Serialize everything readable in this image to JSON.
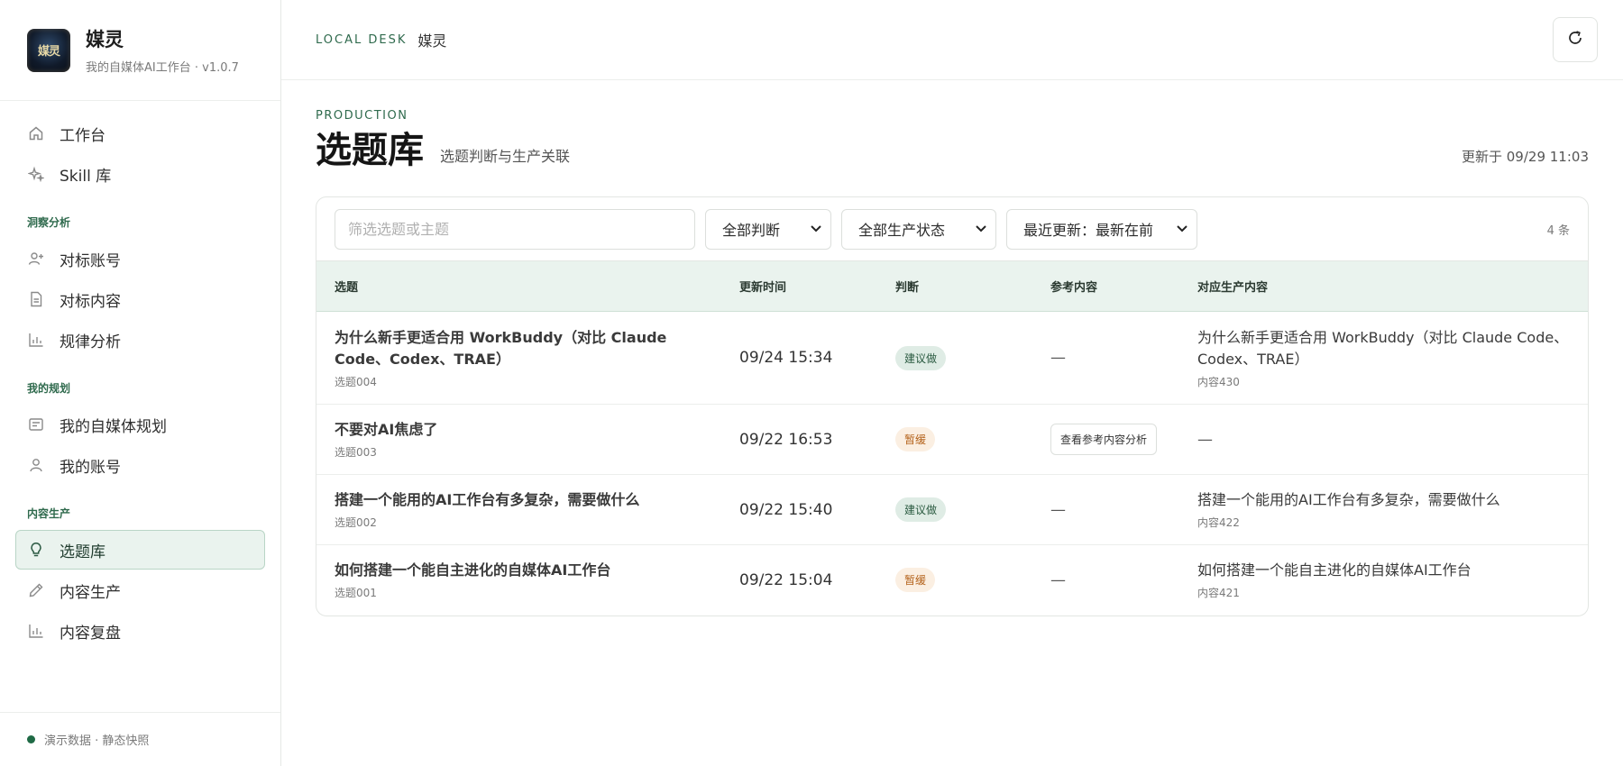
{
  "brand": {
    "name": "媒灵",
    "subtitle": "我的自媒体AI工作台 · v1.0.7",
    "logo_text": "媒灵"
  },
  "nav": {
    "top": [
      {
        "label": "工作台",
        "icon": "home-icon"
      },
      {
        "label": "Skill 库",
        "icon": "sparkle-icon"
      }
    ],
    "sections": [
      {
        "title": "洞察分析",
        "items": [
          {
            "label": "对标账号",
            "icon": "user-plus-icon"
          },
          {
            "label": "对标内容",
            "icon": "document-icon"
          },
          {
            "label": "规律分析",
            "icon": "bar-chart-icon"
          }
        ]
      },
      {
        "title": "我的规划",
        "items": [
          {
            "label": "我的自媒体规划",
            "icon": "list-icon"
          },
          {
            "label": "我的账号",
            "icon": "user-icon"
          }
        ]
      },
      {
        "title": "内容生产",
        "items": [
          {
            "label": "选题库",
            "icon": "lightbulb-icon",
            "active": true
          },
          {
            "label": "内容生产",
            "icon": "pencil-icon"
          },
          {
            "label": "内容复盘",
            "icon": "bar-chart-icon"
          }
        ]
      }
    ]
  },
  "footer": {
    "status": "演示数据 · 静态快照",
    "status_color": "#1f6a45"
  },
  "topbar": {
    "crumb_en": "LOCAL DESK",
    "crumb_cn": "媒灵",
    "refresh_icon": "refresh-icon"
  },
  "page": {
    "section_tag": "PRODUCTION",
    "title": "选题库",
    "subtitle": "选题判断与生产关联",
    "updated": "更新于 09/29 11:03"
  },
  "filters": {
    "search_placeholder": "筛选选题或主题",
    "judgement": "全部判断",
    "status": "全部生产状态",
    "sort": "最近更新：最新在前",
    "count": "4 条"
  },
  "table": {
    "headers": [
      "选题",
      "更新时间",
      "判断",
      "参考内容",
      "对应生产内容"
    ],
    "rows": [
      {
        "title": "为什么新手更适合用 WorkBuddy（对比 Claude Code、Codex、TRAE）",
        "id": "选题004",
        "time": "09/24 15:34",
        "judgement": "建议做",
        "kind": "go",
        "ref": "—",
        "prod_title": "为什么新手更适合用 WorkBuddy（对比 Claude Code、Codex、TRAE）",
        "prod_id": "内容430"
      },
      {
        "title": "不要对AI焦虑了",
        "id": "选题003",
        "time": "09/22 16:53",
        "judgement": "暂缓",
        "kind": "hold",
        "ref": "查看参考内容分析",
        "prod_title": "—",
        "prod_id": ""
      },
      {
        "title": "搭建一个能用的AI工作台有多复杂，需要做什么",
        "id": "选题002",
        "time": "09/22 15:40",
        "judgement": "建议做",
        "kind": "go",
        "ref": "—",
        "prod_title": "搭建一个能用的AI工作台有多复杂，需要做什么",
        "prod_id": "内容422"
      },
      {
        "title": "如何搭建一个能自主进化的自媒体AI工作台",
        "id": "选题001",
        "time": "09/22 15:04",
        "judgement": "暂缓",
        "kind": "hold",
        "ref": "—",
        "prod_title": "如何搭建一个能自主进化的自媒体AI工作台",
        "prod_id": "内容421"
      }
    ]
  }
}
